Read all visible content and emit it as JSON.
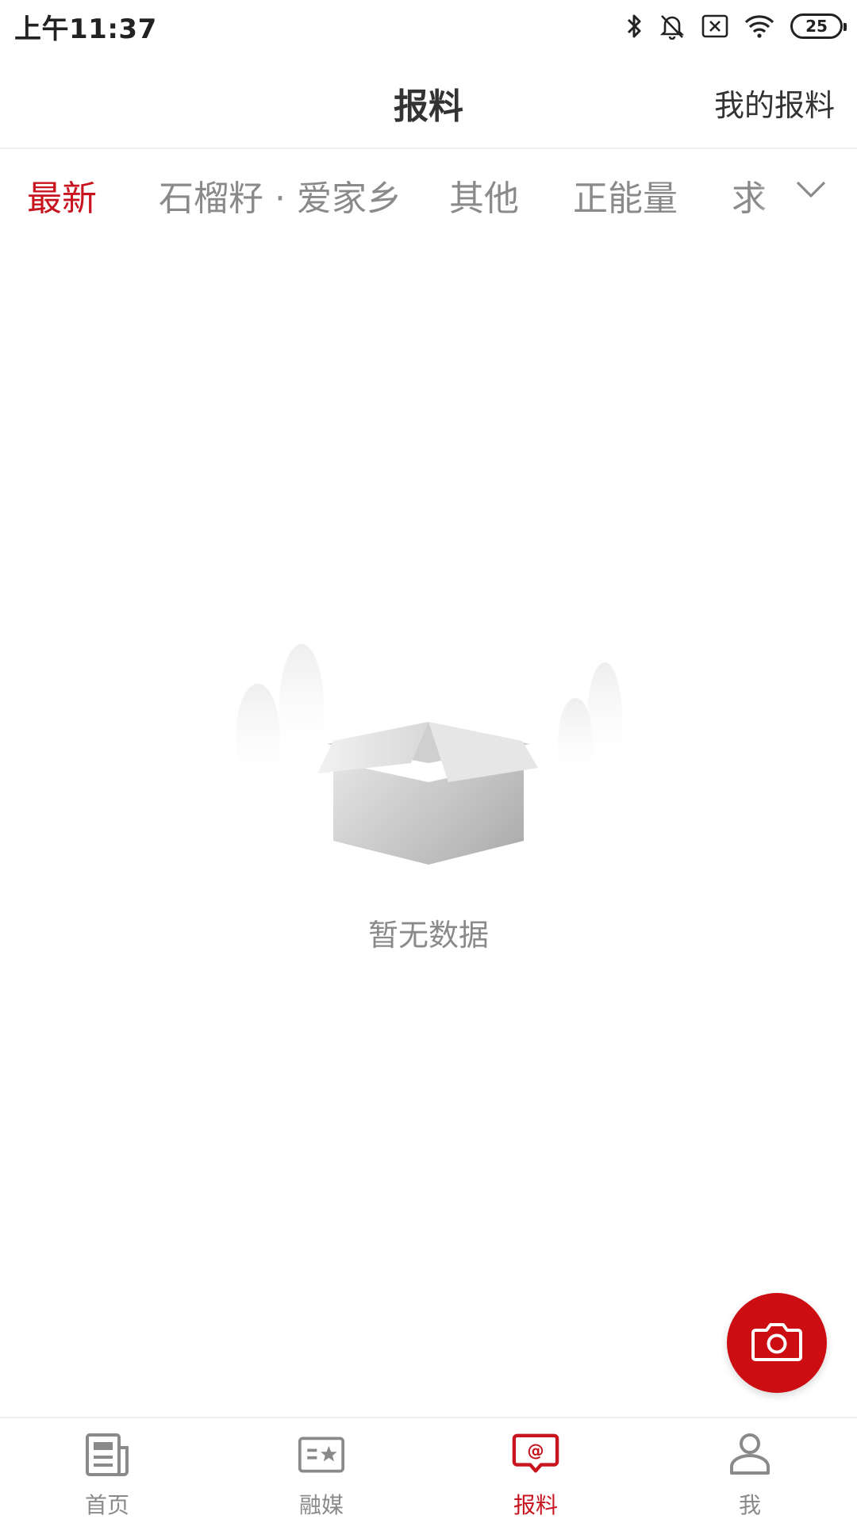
{
  "status_bar": {
    "time": "上午11:37",
    "battery": "25",
    "icons": [
      "bluetooth-icon",
      "mute-bell-icon",
      "sim-x-icon",
      "wifi-icon",
      "battery-icon"
    ]
  },
  "header": {
    "title": "报料",
    "right_link": "我的报料"
  },
  "tabs": [
    {
      "label": "最新",
      "active": true
    },
    {
      "label": "石榴籽 · 爱家乡",
      "active": false
    },
    {
      "label": "其他",
      "active": false
    },
    {
      "label": "正能量",
      "active": false
    },
    {
      "label": "求",
      "active": false
    }
  ],
  "tabs_more_icon": "chevron-down-icon",
  "empty_state": {
    "icon": "empty-box-icon",
    "text": "暂无数据"
  },
  "fab": {
    "icon": "camera-icon",
    "color": "#cc0d12"
  },
  "bottom_nav": [
    {
      "label": "首页",
      "icon": "news-icon",
      "active": false
    },
    {
      "label": "融媒",
      "icon": "media-card-icon",
      "active": false
    },
    {
      "label": "报料",
      "icon": "report-chat-icon",
      "active": true
    },
    {
      "label": "我",
      "icon": "user-icon",
      "active": false
    }
  ],
  "colors": {
    "accent": "#c8141e",
    "inactive": "#8a8a8a",
    "text": "#333333"
  }
}
